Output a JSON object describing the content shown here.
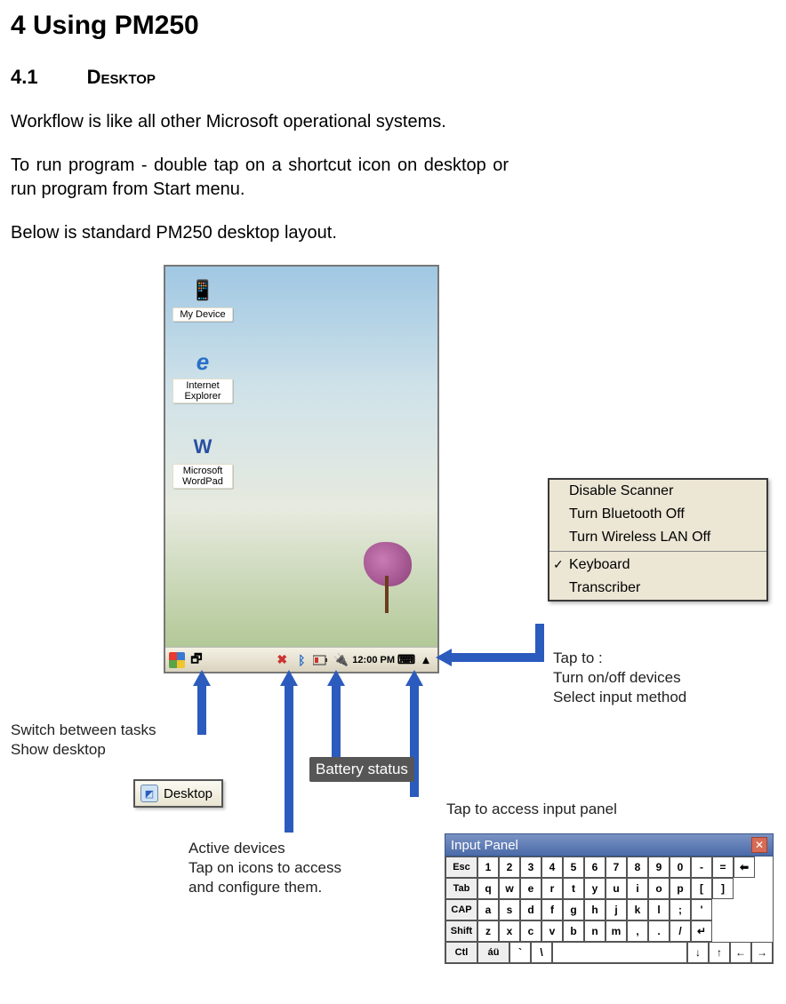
{
  "headings": {
    "section": "4       Using PM250",
    "subsection_num": "4.1",
    "subsection_title": "Desktop"
  },
  "paragraphs": {
    "p1": "Workflow is like all other Microsoft operational systems.",
    "p2": "To run program - double tap on a shortcut icon on desktop or run program from Start menu.",
    "p3": "Below is standard PM250 desktop layout."
  },
  "desktop_icons": [
    {
      "label": "My Device"
    },
    {
      "label": "Internet Explorer"
    },
    {
      "label": "Microsoft WordPad"
    }
  ],
  "taskbar": {
    "clock": "12:00 PM"
  },
  "context_menu": {
    "items": [
      {
        "label": "Disable Scanner",
        "checked": false
      },
      {
        "label": "Turn Bluetooth Off",
        "checked": false
      },
      {
        "label": "Turn Wireless LAN Off",
        "checked": false
      }
    ],
    "below_divider": [
      {
        "label": "Keyboard",
        "checked": true
      },
      {
        "label": "Transcriber",
        "checked": false
      }
    ]
  },
  "annotations": {
    "switch_tasks_line1": "Switch between tasks",
    "switch_tasks_line2": "Show desktop",
    "desktop_button": "Desktop",
    "active_devices_line1": "Active devices",
    "active_devices_line2": "Tap on icons to access",
    "active_devices_line3": "and configure them.",
    "battery_status": "Battery status",
    "tap_devices_line1": "Tap to :",
    "tap_devices_line2": "Turn on/off devices",
    "tap_devices_line3": "Select input method",
    "tap_input_panel": "Tap to access input panel"
  },
  "input_panel": {
    "title": "Input Panel",
    "rows": [
      [
        "Esc",
        "1",
        "2",
        "3",
        "4",
        "5",
        "6",
        "7",
        "8",
        "9",
        "0",
        "-",
        "=",
        "⬅"
      ],
      [
        "Tab",
        "q",
        "w",
        "e",
        "r",
        "t",
        "y",
        "u",
        "i",
        "o",
        "p",
        "[",
        "]"
      ],
      [
        "CAP",
        "a",
        "s",
        "d",
        "f",
        "g",
        "h",
        "j",
        "k",
        "l",
        ";",
        "'"
      ],
      [
        "Shift",
        "z",
        "x",
        "c",
        "v",
        "b",
        "n",
        "m",
        ",",
        ".",
        "/",
        "↵"
      ],
      [
        "Ctl",
        "áü",
        "`",
        "\\",
        " ",
        "↓",
        "↑",
        "←",
        "→"
      ]
    ]
  }
}
